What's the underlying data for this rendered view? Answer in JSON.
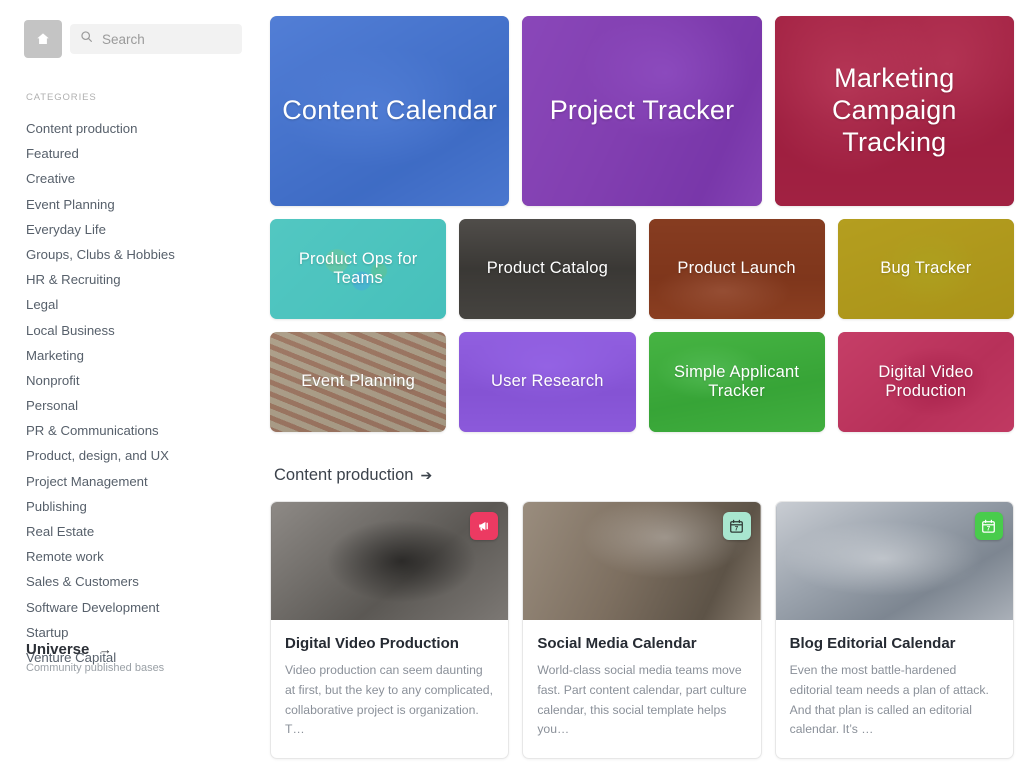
{
  "sidebar": {
    "home_icon": "home-icon",
    "search": {
      "placeholder": "Search",
      "value": ""
    },
    "categories_label": "CATEGORIES",
    "categories": [
      "Content production",
      "Featured",
      "Creative",
      "Event Planning",
      "Everyday Life",
      "Groups, Clubs & Hobbies",
      "HR & Recruiting",
      "Legal",
      "Local Business",
      "Marketing",
      "Nonprofit",
      "Personal",
      "PR & Communications",
      "Product, design, and UX",
      "Project Management",
      "Publishing",
      "Real Estate",
      "Remote work",
      "Sales & Customers",
      "Software Development",
      "Startup",
      "Venture Capital"
    ],
    "universe": {
      "title": "Universe",
      "arrow": "→",
      "subtitle": "Community published bases"
    }
  },
  "hero_tiles": [
    {
      "name": "Content Calendar",
      "tint": "rgba(41,98,214,0.74)",
      "photo": "ph-laptop"
    },
    {
      "name": "Project Tracker",
      "tint": "rgba(132,45,208,0.72)",
      "photo": "ph-desk"
    },
    {
      "name": "Marketing Campaign Tracking",
      "tint": "rgba(205,26,70,0.70)",
      "photo": "ph-city"
    }
  ],
  "small_tiles_row1": [
    {
      "name": "Product Ops for Teams",
      "tint": "rgba(72,198,193,0.55)",
      "photo": "ph-balls"
    },
    {
      "name": "Product Catalog",
      "tint": "rgba(58,56,53,0.58)",
      "photo": "ph-warehouse"
    },
    {
      "name": "Product Launch",
      "tint": "rgba(150,58,26,0.74)",
      "photo": "ph-rocket"
    },
    {
      "name": "Bug Tracker",
      "tint": "rgba(201,168,18,0.66)",
      "photo": "ph-bug"
    }
  ],
  "small_tiles_row2": [
    {
      "name": "Event Planning",
      "tint": "rgba(150,135,108,0.45)",
      "photo": "ph-seats"
    },
    {
      "name": "User Research",
      "tint": "rgba(123,56,236,0.72)",
      "photo": "ph-room"
    },
    {
      "name": "Simple Applicant Tracker",
      "tint": "rgba(52,192,60,0.68)",
      "photo": "ph-leaf"
    },
    {
      "name": "Digital Video Production",
      "tint": "rgba(219,33,91,0.72)",
      "photo": "ph-camera"
    }
  ],
  "section": {
    "title": "Content production",
    "arrow": "➔"
  },
  "templates": [
    {
      "title": "Digital Video Production",
      "description": "Video production can seem daunting at first, but the key to any complicated, collaborative project is organization. T…",
      "badge_icon": "megaphone-icon",
      "badge_bg": "#ec3a62",
      "badge_fg": "#ffffff",
      "photo": "ph-camera"
    },
    {
      "title": "Social Media Calendar",
      "description": "World-class social media teams move fast. Part content calendar, part culture calendar, this social template helps you…",
      "badge_icon": "calendar-icon",
      "badge_bg": "#a8e6cf",
      "badge_fg": "#2f3b36",
      "photo": "ph-desk"
    },
    {
      "title": "Blog Editorial Calendar",
      "description": "Even the most battle-hardened editorial team needs a plan of attack. And that plan is called an editorial calendar. It’s …",
      "badge_icon": "calendar-icon",
      "badge_bg": "#49cc4c",
      "badge_fg": "#ffffff",
      "photo": "ph-laptop"
    }
  ],
  "colors": {
    "sidebar_text": "#57606b",
    "muted": "#9aa0a6",
    "accent_red": "#ec3a62",
    "accent_green": "#49cc4c",
    "accent_mint": "#a8e6cf"
  }
}
